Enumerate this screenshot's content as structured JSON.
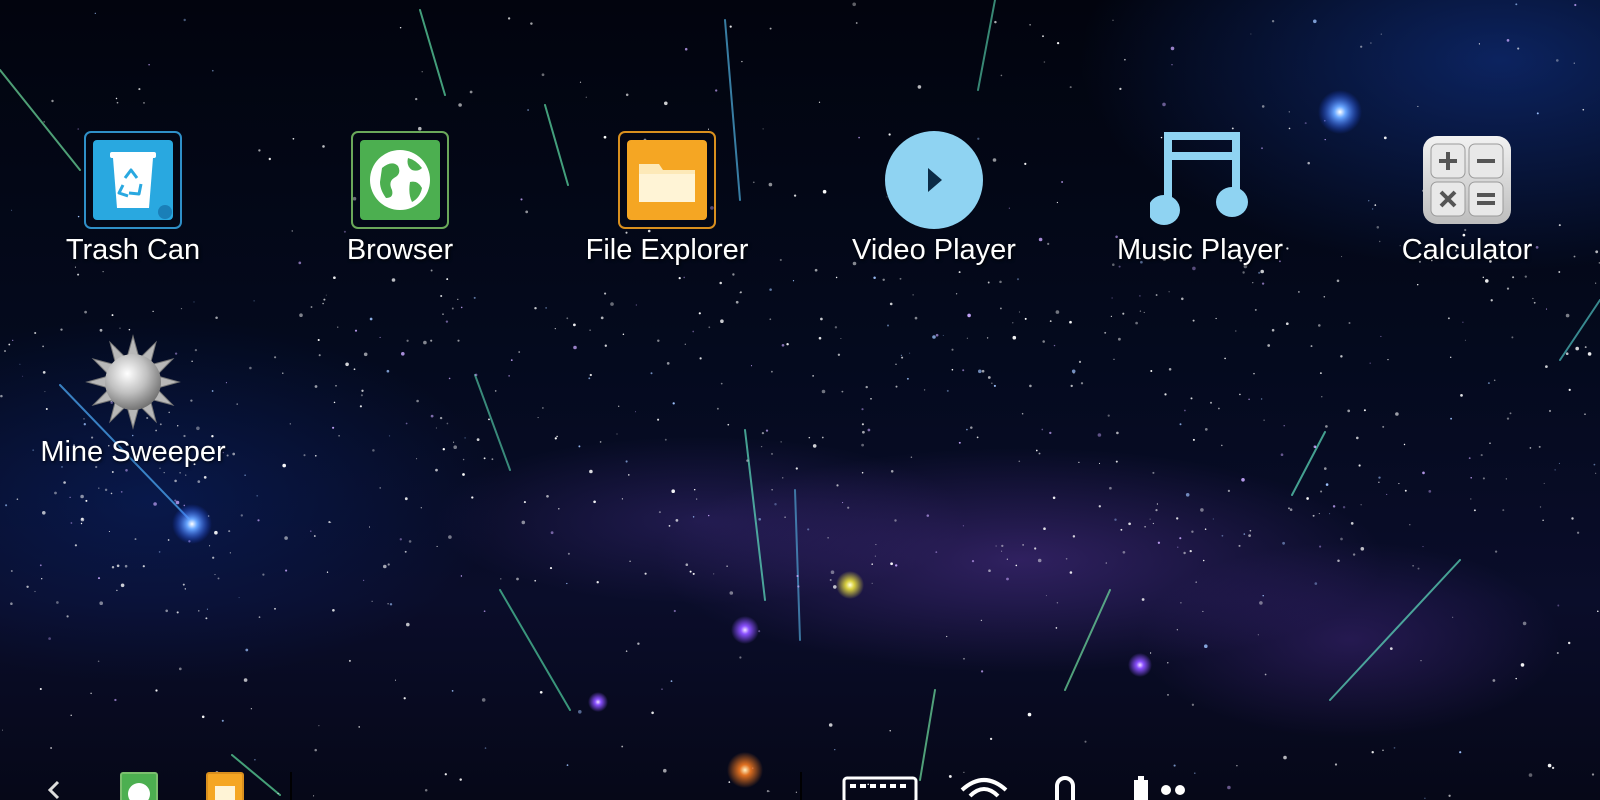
{
  "desktop": {
    "wallpaper": "starfield-galaxy",
    "icons": [
      {
        "label": "Trash Can",
        "icon": "recycle-bin-icon",
        "color": "#29a8e0"
      },
      {
        "label": "Browser",
        "icon": "globe-icon",
        "color": "#4caf50"
      },
      {
        "label": "File Explorer",
        "icon": "folder-icon",
        "color": "#f5a623"
      },
      {
        "label": "Video Player",
        "icon": "play-icon",
        "color": "#8fd3f2"
      },
      {
        "label": "Music Player",
        "icon": "music-note-icon",
        "color": "#8fd3f2"
      },
      {
        "label": "Calculator",
        "icon": "calculator-icon",
        "color": "#d9d9d9"
      },
      {
        "label": "Mine Sweeper",
        "icon": "mine-icon",
        "color": "#c0c0c0"
      }
    ]
  },
  "taskbar": {
    "pinned": [
      "browser-icon",
      "file-explorer-icon"
    ],
    "tray": [
      "keyboard-icon",
      "wifi-icon",
      "lock-icon",
      "battery-icon"
    ]
  }
}
